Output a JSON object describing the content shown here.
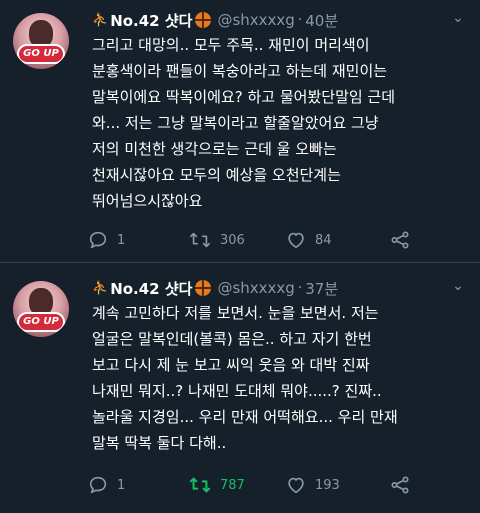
{
  "colors": {
    "background": "#15202b",
    "secondary_text": "#8899a6",
    "retweet_active": "#17bf63",
    "divider": "#38444d"
  },
  "tweets": [
    {
      "display_name": "No.42 샷다",
      "handle": "@shxxxxg",
      "time": "40분",
      "avatar_logo": "GO UP",
      "lines": [
        "그리고 대망의.. 모두 주목.. 재민이 머리색이",
        "분홍색이라 팬들이 복숭아라고 하는데 재민이는",
        "말복이에요 딱복이에요? 하고 물어봤단말임 근데",
        "와... 저는 그냥 말복이라고 할줄알았어요 그냥",
        "저의 미천한 생각으로는 근데 울 오빠는",
        "천재시잖아요 모두의 예상을 오천단계는",
        "뛰어넘으시잖아요"
      ],
      "replies": "1",
      "retweets": "306",
      "likes": "84"
    },
    {
      "display_name": "No.42 샷다",
      "handle": "@shxxxxg",
      "time": "37분",
      "avatar_logo": "GO UP",
      "lines": [
        "계속 고민하다 저를 보면서. 눈을 보면서. 저는",
        "얼굴은 말복인데(볼콕) 몸은.. 하고 자기 한번",
        "보고 다시 제 눈 보고 씨익 웃음 와 대박 진짜",
        "나재민 뭐지..? 나재민 도대체 뭐야.....? 진짜..",
        "놀라울 지경임... 우리 만재 어떡해요... 우리 만재",
        "말복 딱복 둘다 다해.."
      ],
      "replies": "1",
      "retweets": "787",
      "likes": "193"
    }
  ]
}
